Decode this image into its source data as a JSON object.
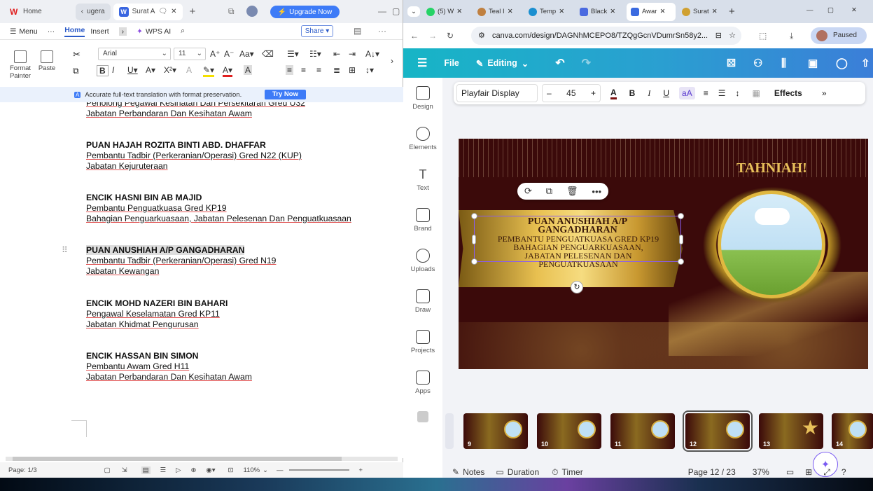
{
  "wps": {
    "tabs": [
      {
        "label": "Home"
      },
      {
        "label": "ugera"
      },
      {
        "label": "Surat A"
      }
    ],
    "upgrade_label": "Upgrade Now",
    "menu": {
      "menu": "Menu",
      "more": "···",
      "home": "Home",
      "insert": "Insert",
      "wps_ai": "WPS AI"
    },
    "share_label": "Share",
    "ribbon": {
      "format_painter": "Format Painter",
      "paste": "Paste",
      "font_name": "Arial",
      "font_size": "11"
    },
    "translation_banner": "Accurate full-text translation with format preservation.",
    "try_now": "Try Now",
    "document": {
      "top_partial_1": "Penolong Pegawai Kesihatan Dan Persekitaran Gred U32",
      "top_partial_2": "Jabatan Perbandaran Dan Kesihatan Awam",
      "entries": [
        {
          "name": "PUAN HAJAH ROZITA BINTI ABD. DHAFFAR",
          "line1": "Pembantu Tadbir (Perkeranian/Operasi) Gred N22 (KUP)",
          "line2": "Jabatan Kejuruteraan"
        },
        {
          "name": "ENCIK HASNI BIN AB MAJID",
          "line1": "Pembantu Penguatkuasa Gred KP19",
          "line2": "Bahagian Penguarkuasaan, Jabatan Pelesenan Dan Penguatkuasaan"
        },
        {
          "name": "PUAN ANUSHIAH A/P GANGADHARAN",
          "line1": "Pembantu Tadbir (Perkeranian/Operasi) Gred N19",
          "line2": "Jabatan Kewangan"
        },
        {
          "name": "ENCIK MOHD NAZERI BIN BAHARI",
          "line1": "Pengawal Keselamatan Gred KP11",
          "line2": "Jabatan Khidmat Pengurusan"
        },
        {
          "name": "ENCIK HASSAN BIN SIMON",
          "line1": "Pembantu Awam Gred H11",
          "line2": "Jabatan Perbandaran Dan Kesihatan Awam"
        }
      ]
    },
    "status": {
      "page": "Page: 1/3",
      "zoom": "110%"
    }
  },
  "chrome": {
    "tabs": [
      {
        "label": "(5) W"
      },
      {
        "label": "Teal I"
      },
      {
        "label": "Temp"
      },
      {
        "label": "Black"
      },
      {
        "label": "Awar"
      },
      {
        "label": "Surat"
      }
    ],
    "url": "canva.com/design/DAGNhMCEPO8/TZQgGcnVDumrSn58y2...",
    "profile": "Paused"
  },
  "canva": {
    "file": "File",
    "editing": "Editing",
    "sidebar": [
      "Design",
      "Elements",
      "Text",
      "Brand",
      "Uploads",
      "Draw",
      "Projects",
      "Apps"
    ],
    "text_toolbar": {
      "font": "Playfair Display",
      "size": "45",
      "effects": "Effects"
    },
    "slide": {
      "heading": "TAHNIAH!",
      "name_line1": "PUAN ANUSHIAH A/P",
      "name_line2": "GANGADHARAN",
      "body_line1": "PEMBANTU PENGUATKUASA GRED KP19",
      "body_line2": "BAHAGIAN PENGUARKUASAAN,",
      "body_line3": "JABATAN PELESENAN DAN",
      "body_line4": "PENGUATKUASAAN"
    },
    "thumbnails": [
      "9",
      "10",
      "11",
      "12",
      "13",
      "14"
    ],
    "selected_thumbnail": "12",
    "bottom": {
      "notes": "Notes",
      "duration": "Duration",
      "timer": "Timer",
      "page": "Page 12 / 23",
      "zoom": "37%"
    }
  },
  "colors": {
    "canva_teal": "#17b5c6",
    "canva_blue": "#3b7ed8",
    "wps_blue": "#2b5ac8",
    "gold": "#d8b040",
    "maroon": "#3b0a0a"
  }
}
